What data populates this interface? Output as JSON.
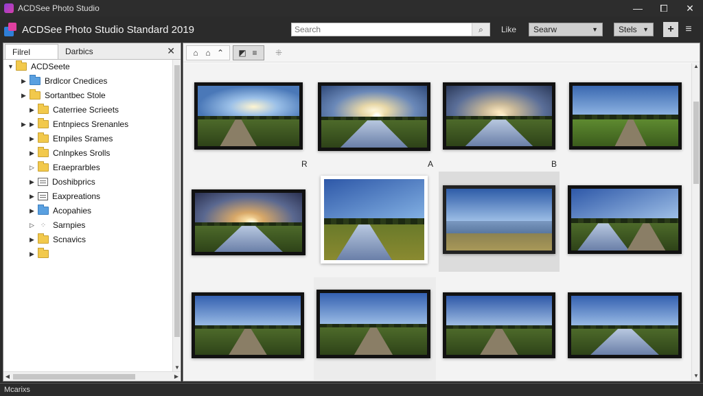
{
  "window": {
    "title": "ACDSee Photo Studio",
    "minimize": "—",
    "maximize": "⧠",
    "close": "✕"
  },
  "header": {
    "app_title": "ACDSee Photo Studio Standard 2019",
    "search_placeholder": "Search",
    "search_icon_glyph": "🔍",
    "like_label": "Like",
    "search_dropdown": "Searw",
    "stats_dropdown": "Stels",
    "add_glyph": "+",
    "menu_glyph": "≡"
  },
  "left_panel": {
    "tabs": [
      {
        "label": "Filrel"
      },
      {
        "label": "Darbics"
      }
    ],
    "close_glyph": "✕",
    "tree": [
      {
        "label": "ACDSeete",
        "icon": "folder-icon",
        "level": 0,
        "expanded": true
      },
      {
        "label": "Brdlcor Cnedices",
        "icon": "blue-folder-icon",
        "level": 1
      },
      {
        "label": "Sortantbec Stole",
        "icon": "folder-icon",
        "level": 1
      },
      {
        "label": "Caterriee Scrieets",
        "icon": "folder-icon",
        "level": 2
      },
      {
        "label": "Entnpiecs Srenanles",
        "icon": "folder-icon",
        "level": 2
      },
      {
        "label": "Etnpiles Srames",
        "icon": "folder-icon",
        "level": 2
      },
      {
        "label": "Cnlnpkes Srolls",
        "icon": "folder-icon",
        "level": 2
      },
      {
        "label": "Eraeprarbles",
        "icon": "folder-icon",
        "level": 2
      },
      {
        "label": "Doshibprics",
        "icon": "document-icon",
        "level": 2
      },
      {
        "label": "Eaxpreations",
        "icon": "folder-outline-icon",
        "level": 2
      },
      {
        "label": "Acopahies",
        "icon": "blue-folder-icon",
        "level": 2
      },
      {
        "label": "Sarnpies",
        "icon": "dots-icon",
        "level": 2
      },
      {
        "label": "Scnavics",
        "icon": "folder-icon",
        "level": 2
      },
      {
        "label": "",
        "icon": "folder-icon",
        "level": 2
      }
    ]
  },
  "right_panel": {
    "toolbar": {
      "group1": [
        "⌂",
        "⌂",
        "⌃"
      ],
      "group2": [
        "◩",
        "≡"
      ],
      "extra": "⁜"
    },
    "thumbnail_labels": [
      {
        "row": 0,
        "col": 1,
        "text": "R"
      },
      {
        "row": 0,
        "col": 2,
        "text": "A"
      },
      {
        "row": 0,
        "col": 3,
        "text": "B"
      }
    ]
  },
  "status_bar": {
    "text": "Mcarixs"
  },
  "colors": {
    "chrome": "#2b2b2b",
    "folder": "#f2c94c",
    "folder_blue": "#5aa0e0"
  }
}
